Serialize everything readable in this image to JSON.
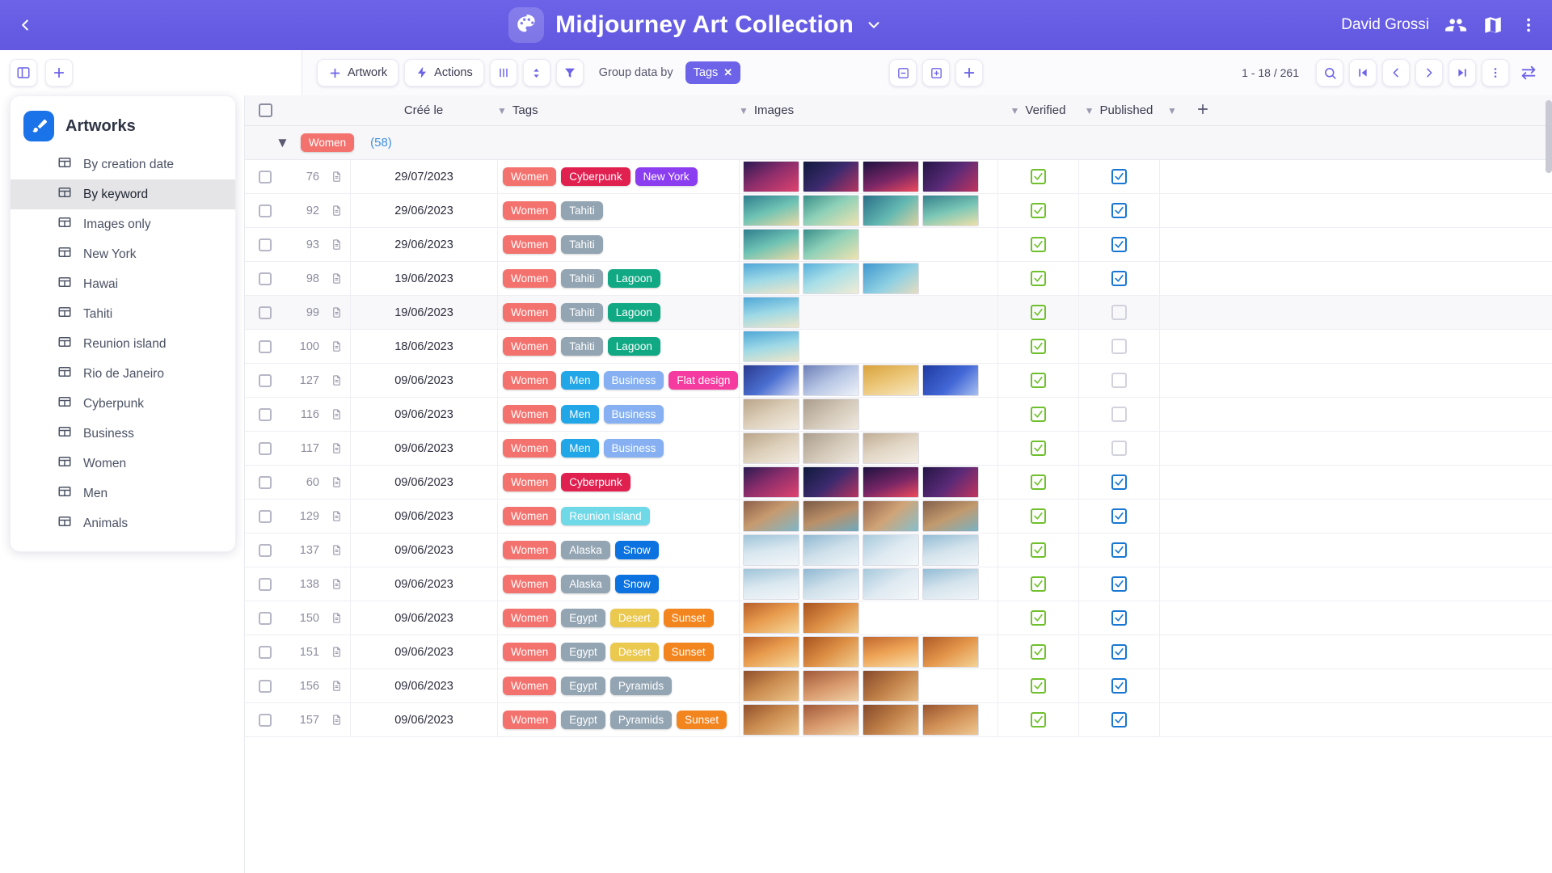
{
  "appbar": {
    "back_icon": "chevron-left-icon",
    "logo_icon": "palette-icon",
    "title": "Midjourney Art Collection",
    "title_chevron": "chevron-down-icon",
    "user_name": "David Grossi",
    "people_icon": "people-icon",
    "map_icon": "map-icon",
    "more_icon": "more-vertical-icon"
  },
  "toolbar": {
    "panel_toggle_icon": "panel-layout-icon",
    "add_panel_icon": "plus-icon",
    "artwork_label": "Artwork",
    "artwork_icon": "plus-icon",
    "actions_label": "Actions",
    "actions_icon": "lightning-icon",
    "columns_icon": "columns-icon",
    "sort_icon": "sort-icon",
    "filter_icon": "filter-icon",
    "group_label": "Group data by",
    "group_chip": "Tags",
    "group_chip_close": "✕",
    "collapse_icon": "collapse-all-icon",
    "expand_icon": "expand-all-icon",
    "plus_icon": "plus-icon",
    "page_count": "1 - 18 / 261",
    "search_icon": "search-icon",
    "first_icon": "first-page-icon",
    "prev_icon": "prev-page-icon",
    "next_icon": "next-page-icon",
    "last_icon": "last-page-icon",
    "more_icon": "more-vertical-icon",
    "swap_icon": "swap-arrows-icon"
  },
  "sidebar": {
    "logo_icon": "paintbrush-icon",
    "title": "Artworks",
    "items": [
      {
        "label": "By creation date",
        "active": false
      },
      {
        "label": "By keyword",
        "active": true
      },
      {
        "label": "Images only",
        "active": false
      },
      {
        "label": "New York",
        "active": false
      },
      {
        "label": "Hawai",
        "active": false
      },
      {
        "label": "Tahiti",
        "active": false
      },
      {
        "label": "Reunion island",
        "active": false
      },
      {
        "label": "Rio de Janeiro",
        "active": false
      },
      {
        "label": "Cyberpunk",
        "active": false
      },
      {
        "label": "Business",
        "active": false
      },
      {
        "label": "Women",
        "active": false
      },
      {
        "label": "Men",
        "active": false
      },
      {
        "label": "Animals",
        "active": false
      }
    ]
  },
  "table": {
    "columns": [
      {
        "label": "Créé le",
        "chevron": false
      },
      {
        "label": "Tags",
        "chevron": true
      },
      {
        "label": "Images",
        "chevron": true
      },
      {
        "label": "Verified",
        "chevron": true
      },
      {
        "label": "Published",
        "chevron": true
      }
    ],
    "add_column_icon": "plus-icon",
    "extra_chevron": "chevron-down-icon",
    "group": {
      "name": "Women",
      "count": "(58)",
      "color": "#f4726e"
    },
    "tag_colors": {
      "Women": "#f4726e",
      "Cyberpunk": "#e0204f",
      "New York": "#8b3df0",
      "Tahiti": "#93a4b2",
      "Lagoon": "#11a884",
      "Men": "#21a6e8",
      "Business": "#86b0f2",
      "Flat design": "#f63ba0",
      "Reunion island": "#6fd9e8",
      "Alaska": "#93a4b2",
      "Snow": "#0b72e0",
      "Egypt": "#93a4b2",
      "Desert": "#ebc84e",
      "Sunset": "#f3851f",
      "Pyramids": "#93a4b2"
    },
    "rows": [
      {
        "id": "76",
        "date": "29/07/2023",
        "tags": [
          "Women",
          "Cyberpunk",
          "New York"
        ],
        "images": 4,
        "verified": true,
        "published": true,
        "alt": false,
        "theme": "cyber"
      },
      {
        "id": "92",
        "date": "29/06/2023",
        "tags": [
          "Women",
          "Tahiti"
        ],
        "images": 4,
        "verified": true,
        "published": true,
        "alt": false,
        "theme": "tahiti"
      },
      {
        "id": "93",
        "date": "29/06/2023",
        "tags": [
          "Women",
          "Tahiti"
        ],
        "images": 2,
        "verified": true,
        "published": true,
        "alt": false,
        "theme": "tahiti"
      },
      {
        "id": "98",
        "date": "19/06/2023",
        "tags": [
          "Women",
          "Tahiti",
          "Lagoon"
        ],
        "images": 3,
        "verified": true,
        "published": true,
        "alt": false,
        "theme": "lagoon"
      },
      {
        "id": "99",
        "date": "19/06/2023",
        "tags": [
          "Women",
          "Tahiti",
          "Lagoon"
        ],
        "images": 1,
        "verified": true,
        "published": false,
        "alt": true,
        "theme": "lagoon"
      },
      {
        "id": "100",
        "date": "18/06/2023",
        "tags": [
          "Women",
          "Tahiti",
          "Lagoon"
        ],
        "images": 1,
        "verified": true,
        "published": false,
        "alt": false,
        "theme": "lagoon"
      },
      {
        "id": "127",
        "date": "09/06/2023",
        "tags": [
          "Women",
          "Men",
          "Business",
          "Flat design"
        ],
        "images": 4,
        "verified": true,
        "published": false,
        "alt": false,
        "theme": "flat"
      },
      {
        "id": "116",
        "date": "09/06/2023",
        "tags": [
          "Women",
          "Men",
          "Business"
        ],
        "images": 2,
        "verified": true,
        "published": false,
        "alt": false,
        "theme": "biz"
      },
      {
        "id": "117",
        "date": "09/06/2023",
        "tags": [
          "Women",
          "Men",
          "Business"
        ],
        "images": 3,
        "verified": true,
        "published": false,
        "alt": false,
        "theme": "biz"
      },
      {
        "id": "60",
        "date": "09/06/2023",
        "tags": [
          "Women",
          "Cyberpunk"
        ],
        "images": 4,
        "verified": true,
        "published": true,
        "alt": false,
        "theme": "cyber"
      },
      {
        "id": "129",
        "date": "09/06/2023",
        "tags": [
          "Women",
          "Reunion island"
        ],
        "images": 4,
        "verified": true,
        "published": true,
        "alt": false,
        "theme": "reunion"
      },
      {
        "id": "137",
        "date": "09/06/2023",
        "tags": [
          "Women",
          "Alaska",
          "Snow"
        ],
        "images": 4,
        "verified": true,
        "published": true,
        "alt": false,
        "theme": "snow"
      },
      {
        "id": "138",
        "date": "09/06/2023",
        "tags": [
          "Women",
          "Alaska",
          "Snow"
        ],
        "images": 4,
        "verified": true,
        "published": true,
        "alt": false,
        "theme": "snow"
      },
      {
        "id": "150",
        "date": "09/06/2023",
        "tags": [
          "Women",
          "Egypt",
          "Desert",
          "Sunset"
        ],
        "images": 2,
        "verified": true,
        "published": true,
        "alt": false,
        "theme": "desert"
      },
      {
        "id": "151",
        "date": "09/06/2023",
        "tags": [
          "Women",
          "Egypt",
          "Desert",
          "Sunset"
        ],
        "images": 4,
        "verified": true,
        "published": true,
        "alt": false,
        "theme": "desert"
      },
      {
        "id": "156",
        "date": "09/06/2023",
        "tags": [
          "Women",
          "Egypt",
          "Pyramids"
        ],
        "images": 3,
        "verified": true,
        "published": true,
        "alt": false,
        "theme": "pyr"
      },
      {
        "id": "157",
        "date": "09/06/2023",
        "tags": [
          "Women",
          "Egypt",
          "Pyramids",
          "Sunset"
        ],
        "images": 4,
        "verified": true,
        "published": true,
        "alt": false,
        "theme": "pyr"
      }
    ]
  }
}
